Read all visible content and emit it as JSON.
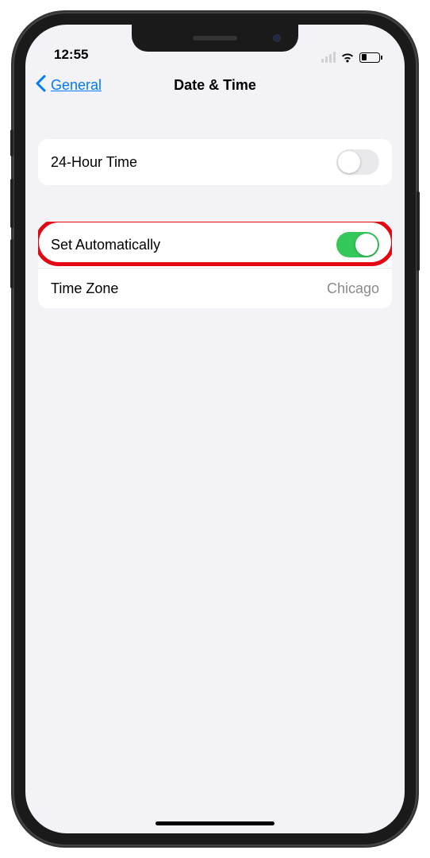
{
  "status": {
    "time": "12:55"
  },
  "nav": {
    "back_label": "General",
    "title": "Date & Time"
  },
  "section1": {
    "row1_label": "24-Hour Time",
    "row1_toggle_on": false
  },
  "section2": {
    "row1_label": "Set Automatically",
    "row1_toggle_on": true,
    "row2_label": "Time Zone",
    "row2_value": "Chicago"
  }
}
